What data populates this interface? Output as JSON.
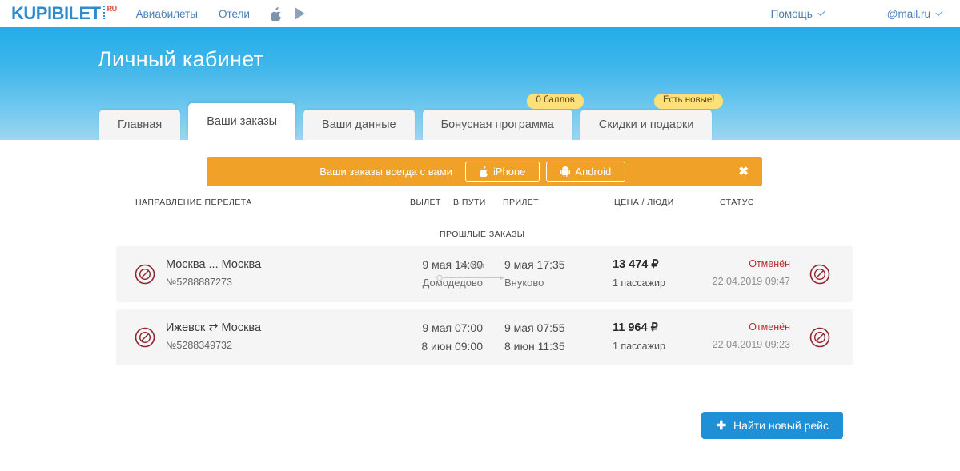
{
  "topnav": {
    "logo_main": "KUPIBILET",
    "logo_suffix": "RU",
    "links": [
      {
        "label": "Авиабилеты",
        "name": "nav-link-flights"
      },
      {
        "label": "Отели",
        "name": "nav-link-hotels"
      }
    ],
    "apple_icon": "apple-icon",
    "play_icon": "google-play-icon",
    "help": "Помощь",
    "account": "@mail.ru"
  },
  "hero": {
    "title": "Личный кабинет",
    "tabs": [
      {
        "label": "Главная",
        "active": false,
        "badge": null
      },
      {
        "label": "Ваши заказы",
        "active": true,
        "badge": null
      },
      {
        "label": "Ваши данные",
        "active": false,
        "badge": null
      },
      {
        "label": "Бонусная программа",
        "active": false,
        "badge": "0 баллов"
      },
      {
        "label": "Скидки и подарки",
        "active": false,
        "badge": "Есть новые!"
      }
    ]
  },
  "promo": {
    "text": "Ваши заказы всегда с вами",
    "iphone_label": "iPhone",
    "android_label": "Android",
    "close_label": "✖"
  },
  "table": {
    "headers": {
      "direction": "НАПРАВЛЕНИЕ ПЕРЕЛЕТА",
      "departure": "ВЫЛЕТ",
      "duration": "В ПУТИ",
      "arrival": "ПРИЛЕТ",
      "price": "ЦЕНА / ЛЮДИ",
      "status": "СТАТУС"
    },
    "past_orders_label": "ПРОШЛЫЕ ЗАКАЗЫ",
    "rows": [
      {
        "route": "Москва ... Москва",
        "route_separator": "...",
        "order_number": "№5288887273",
        "departure_time": "9 мая 14:30",
        "departure_place": "Домодедово",
        "duration": "3ч 05м",
        "arrival_time": "9 мая 17:35",
        "arrival_place": "Внуково",
        "price": "13 474 ₽",
        "passengers": "1 пассажир",
        "status": "Отменён",
        "status_date": "22.04.2019 09:47",
        "status_icon": "cancelled-icon"
      },
      {
        "route": "Ижевск ⇄ Москва",
        "route_separator": "⇄",
        "order_number": "№5288349732",
        "departure_time": "9 мая 07:00",
        "departure_place": "8 июн 09:00",
        "duration": "",
        "arrival_time": "9 мая 07:55",
        "arrival_place": "8 июн 11:35",
        "price": "11 964 ₽",
        "passengers": "1 пассажир",
        "status": "Отменён",
        "status_date": "22.04.2019 09:23",
        "status_icon": "cancelled-icon"
      }
    ]
  },
  "footer_action": {
    "plus": "✚",
    "label": "Найти новый рейс"
  },
  "colors": {
    "brand_blue": "#2d8ccd",
    "hero_top": "#23ade9",
    "hero_bottom": "#9bd6ef",
    "promo_orange": "#f0a128",
    "badge_yellow": "#fee07a",
    "cancelled_red": "#b33030",
    "button_blue": "#1f8fd6"
  }
}
